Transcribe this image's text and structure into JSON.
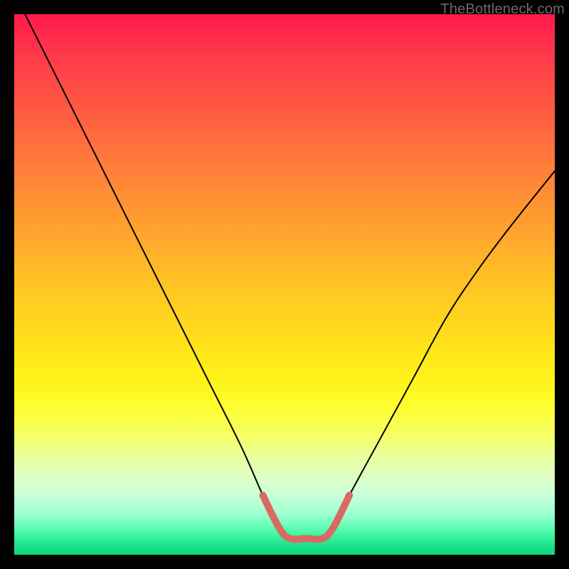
{
  "watermark": "TheBottleneck.com",
  "chart_data": {
    "type": "line",
    "title": "",
    "xlabel": "",
    "ylabel": "",
    "xlim": [
      0,
      100
    ],
    "ylim": [
      0,
      100
    ],
    "grid": false,
    "series": [
      {
        "name": "bottleneck-curve",
        "x": [
          2,
          6,
          12,
          18,
          24,
          30,
          36,
          42,
          46,
          49,
          51,
          54,
          57,
          59,
          62,
          68,
          74,
          80,
          86,
          92,
          100
        ],
        "values": [
          100,
          92,
          80,
          68,
          56,
          44,
          32,
          20,
          11,
          5,
          3,
          3,
          3,
          5,
          11,
          22,
          33,
          44,
          53,
          61,
          71
        ]
      }
    ],
    "highlight": {
      "name": "optimal-range",
      "color": "#d86a63",
      "x": [
        46,
        49,
        51,
        54,
        57,
        59,
        62
      ],
      "values": [
        11,
        5,
        3,
        3,
        3,
        5,
        11
      ]
    }
  }
}
